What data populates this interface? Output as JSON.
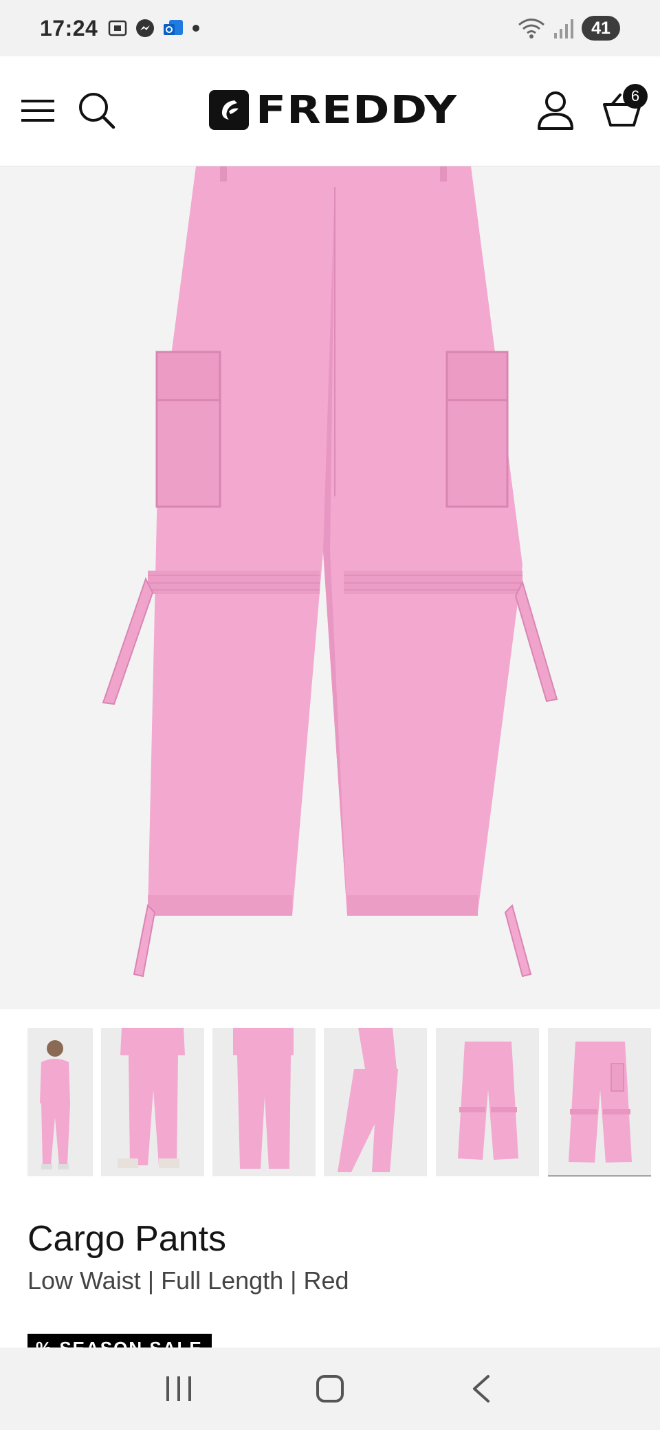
{
  "status_bar": {
    "time": "17:24",
    "battery": "41",
    "icons": [
      "screenshot-icon",
      "messenger-icon",
      "outlook-icon",
      "dot-icon",
      "wifi-icon",
      "signal-icon"
    ]
  },
  "header": {
    "brand": "FREDDY",
    "cart_count": "6",
    "icons": [
      "menu-icon",
      "search-icon",
      "account-icon",
      "cart-icon"
    ]
  },
  "product": {
    "name": "Cargo Pants",
    "details": "Low Waist | Full Length | Red",
    "badge": "% SEASON SALE",
    "main_image": "pink-cargo-pants-product-image",
    "thumbnails": [
      {
        "alt": "model-front-full"
      },
      {
        "alt": "model-front-closeup"
      },
      {
        "alt": "model-back"
      },
      {
        "alt": "model-side"
      },
      {
        "alt": "product-flat-back"
      },
      {
        "alt": "product-flat-front",
        "active": true
      }
    ]
  },
  "colors": {
    "pink": "#f2a8cf",
    "pink_dark": "#e48cbd",
    "black": "#111111",
    "bg_grey": "#f3f3f3"
  },
  "nav_bar": {
    "buttons": [
      "recents-icon",
      "home-icon",
      "back-icon"
    ]
  }
}
